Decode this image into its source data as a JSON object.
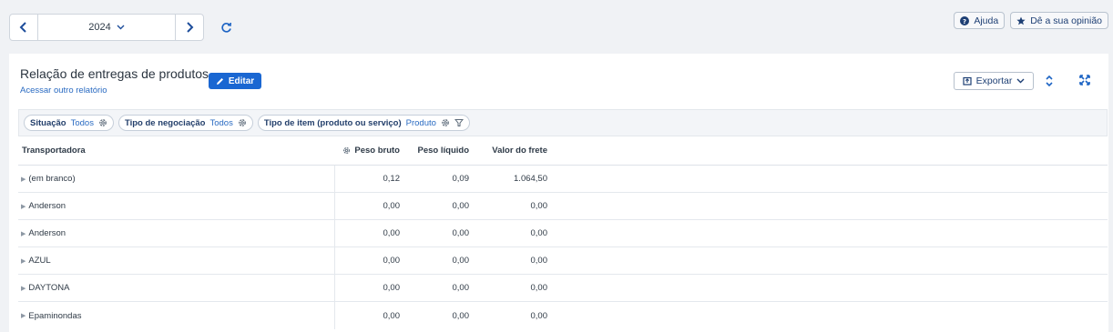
{
  "nav": {
    "year": "2024"
  },
  "top_buttons": {
    "help": "Ajuda",
    "feedback": "Dê a sua opinião"
  },
  "report": {
    "title": "Relação de entregas de produtos",
    "link": "Acessar outro relatório",
    "edit": "Editar",
    "export": "Exportar"
  },
  "filters": [
    {
      "key": "Situação",
      "value": "Todos"
    },
    {
      "key": "Tipo de negociação",
      "value": "Todos"
    },
    {
      "key": "Tipo de item (produto ou serviço)",
      "value": "Produto"
    }
  ],
  "table": {
    "columns": [
      "Transportadora",
      "Peso bruto",
      "Peso líquido",
      "Valor do frete"
    ],
    "rows": [
      {
        "name": "(em branco)",
        "peso_bruto": "0,12",
        "peso_liquido": "0,09",
        "frete": "1.064,50"
      },
      {
        "name": "Anderson",
        "peso_bruto": "0,00",
        "peso_liquido": "0,00",
        "frete": "0,00"
      },
      {
        "name": "Anderson",
        "peso_bruto": "0,00",
        "peso_liquido": "0,00",
        "frete": "0,00"
      },
      {
        "name": "AZUL",
        "peso_bruto": "0,00",
        "peso_liquido": "0,00",
        "frete": "0,00"
      },
      {
        "name": "DAYTONA",
        "peso_bruto": "0,00",
        "peso_liquido": "0,00",
        "frete": "0,00"
      },
      {
        "name": "Epaminondas",
        "peso_bruto": "0,00",
        "peso_liquido": "0,00",
        "frete": "0,00"
      }
    ]
  },
  "icons": {
    "prev": "chevron-left-icon",
    "next": "chevron-right-icon",
    "year_dropdown": "chevron-down-icon",
    "refresh": "refresh-icon",
    "help": "question-circle-icon",
    "feedback": "star-icon",
    "edit": "pencil-icon",
    "export": "export-icon",
    "collapse": "expand-collapse-icon",
    "fullscreen": "fullscreen-icon",
    "filter_settings": "gear-icon",
    "filter": "funnel-icon"
  },
  "colors": {
    "accent": "#1a67d2",
    "link": "#2a6bc2",
    "background": "#f0f2f5"
  }
}
